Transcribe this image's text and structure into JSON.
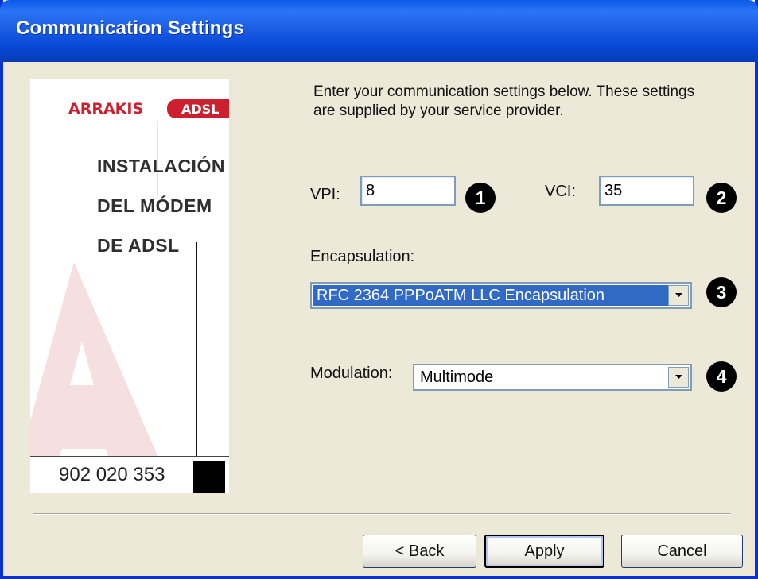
{
  "window": {
    "title": "Communication Settings"
  },
  "brand": {
    "logo_text": "ARRAKIS",
    "logo_badge": "ADSL",
    "lines": [
      "INSTALACIÓN",
      "DEL MÓDEM",
      "DE ADSL"
    ],
    "phone": "902 020 353",
    "colors": {
      "logo_red": "#cc1f2f",
      "watermark": "#f3d7d9"
    }
  },
  "instructions": "Enter your communication settings below.  These settings are supplied by your service provider.",
  "fields": {
    "vpi": {
      "label": "VPI:",
      "value": "8",
      "badge": "1"
    },
    "vci": {
      "label": "VCI:",
      "value": "35",
      "badge": "2"
    },
    "encapsulation": {
      "label": "Encapsulation:",
      "value": "RFC 2364 PPPoATM LLC Encapsulation",
      "badge": "3"
    },
    "modulation": {
      "label": "Modulation:",
      "value": "Multimode",
      "badge": "4"
    }
  },
  "buttons": {
    "back": "< Back",
    "apply": "Apply",
    "cancel": "Cancel"
  },
  "icons": {
    "dropdown": "chevron-down-icon",
    "watermark": "arrakis-a-icon"
  }
}
